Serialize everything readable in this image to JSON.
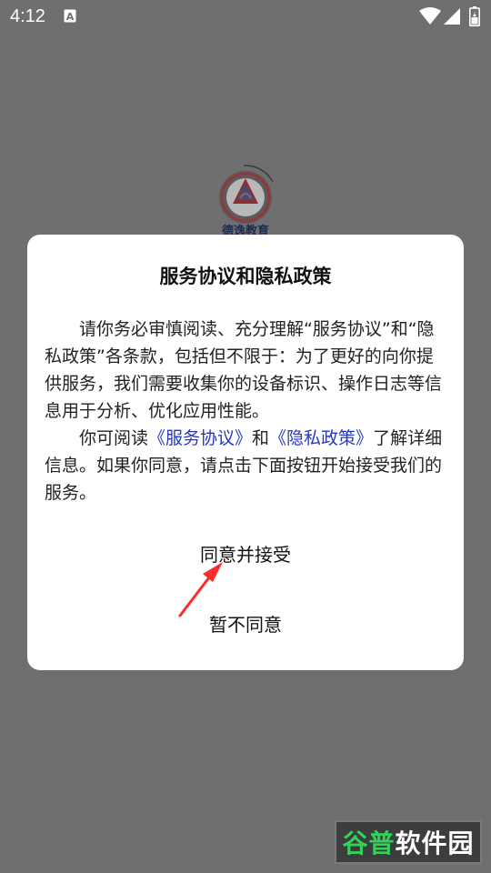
{
  "status_bar": {
    "time": "4:12",
    "notification_letter": "A"
  },
  "app": {
    "logo_text": "德逸教育"
  },
  "dialog": {
    "title": "服务协议和隐私政策",
    "paragraph1": "请你务必审慎阅读、充分理解“服务协议”和“隐私政策”各条款，包括但不限于：为了更好的向你提供服务，我们需要收集你的设备标识、操作日志等信息用于分析、优化应用性能。",
    "paragraph2_prefix": "你可阅读",
    "service_link": "《服务协议》",
    "paragraph2_middle": "和",
    "privacy_link": "《隐私政策》",
    "paragraph2_suffix": "了解详细信息。如果你同意，请点击下面按钮开始接受我们的服务。",
    "agree_label": "同意并接受",
    "disagree_label": "暂不同意"
  },
  "watermark": {
    "part1": "谷普",
    "part2": "软件园"
  },
  "colors": {
    "overlay": "#6f6f6f",
    "dialog_bg": "#ffffff",
    "link": "#2438c2",
    "arrow": "#ff2a2a",
    "watermark_green": "#33d35b"
  }
}
